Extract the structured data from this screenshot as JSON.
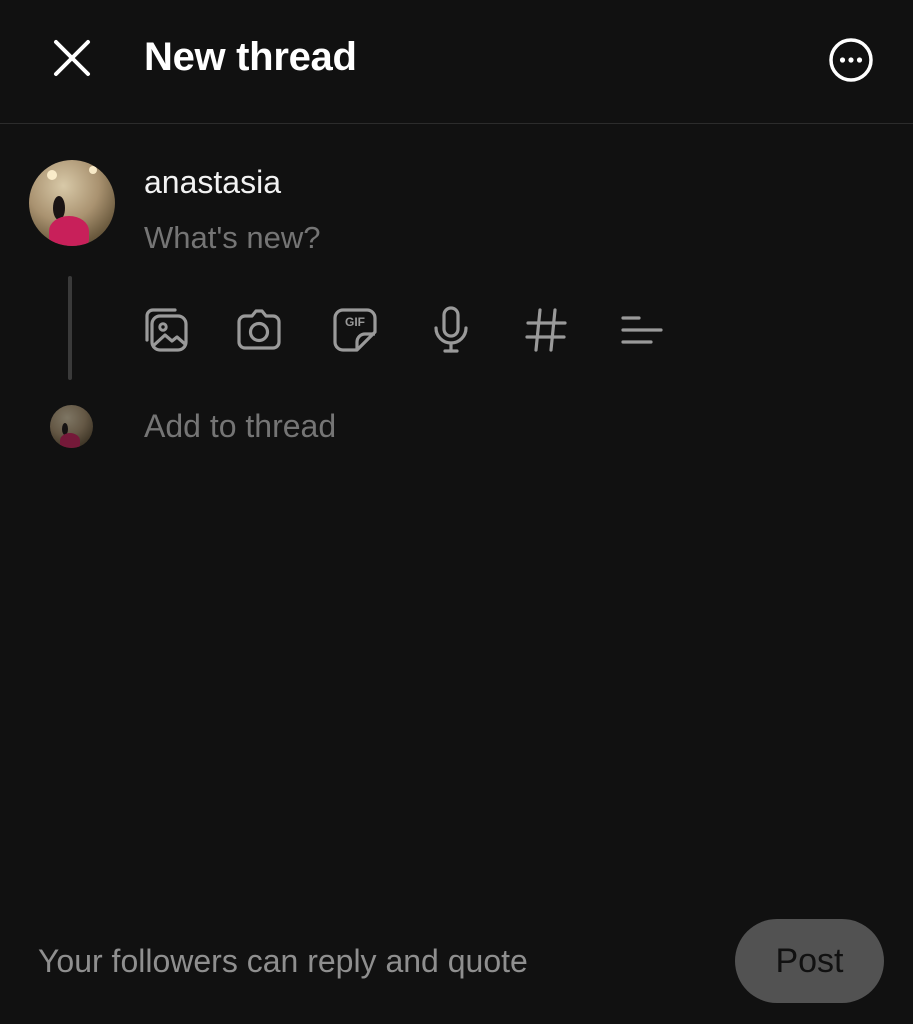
{
  "header": {
    "title": "New thread",
    "close_icon": "close-icon",
    "more_icon": "more-horizontal-circle-icon"
  },
  "composer": {
    "username": "anastasia",
    "placeholder": "What's new?",
    "toolbar": [
      {
        "name": "gallery-icon"
      },
      {
        "name": "camera-icon"
      },
      {
        "name": "gif-icon"
      },
      {
        "name": "microphone-icon"
      },
      {
        "name": "hashtag-icon"
      },
      {
        "name": "poll-icon"
      }
    ],
    "add_to_thread_placeholder": "Add to thread"
  },
  "footer": {
    "reply_setting": "Your followers can reply and quote",
    "post_label": "Post"
  },
  "colors": {
    "background": "#111111",
    "text_primary": "#ffffff",
    "text_secondary": "#8a8a8a",
    "icon": "#9a9a9a",
    "post_button_disabled": "#525252"
  }
}
